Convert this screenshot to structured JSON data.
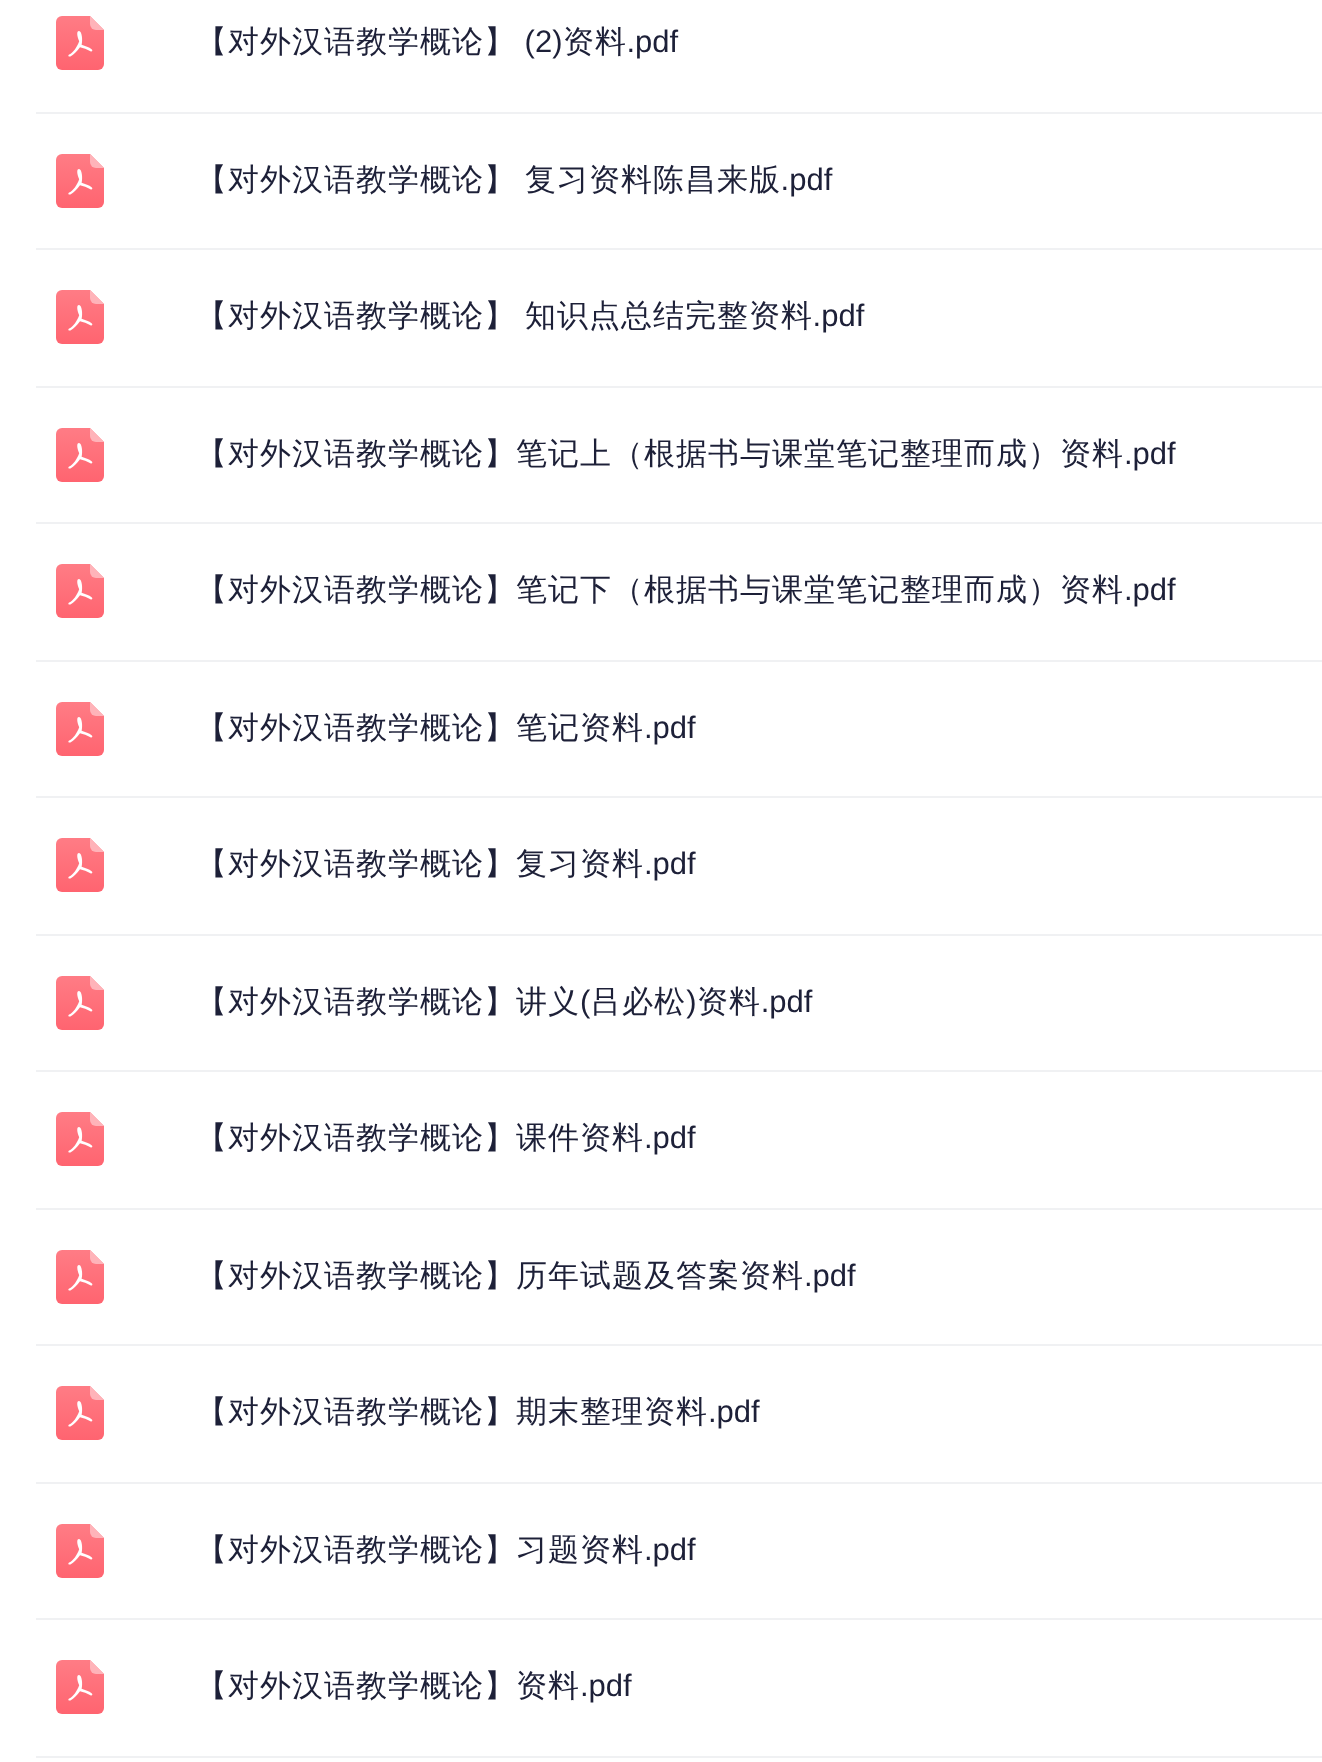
{
  "files": [
    {
      "name": "【对外汉语教学概论】 (2)资料.pdf"
    },
    {
      "name": "【对外汉语教学概论】 复习资料陈昌来版.pdf"
    },
    {
      "name": "【对外汉语教学概论】 知识点总结完整资料.pdf"
    },
    {
      "name": "【对外汉语教学概论】笔记上（根据书与课堂笔记整理而成）资料.pdf"
    },
    {
      "name": "【对外汉语教学概论】笔记下（根据书与课堂笔记整理而成）资料.pdf"
    },
    {
      "name": "【对外汉语教学概论】笔记资料.pdf"
    },
    {
      "name": "【对外汉语教学概论】复习资料.pdf"
    },
    {
      "name": "【对外汉语教学概论】讲义(吕必松)资料.pdf"
    },
    {
      "name": "【对外汉语教学概论】课件资料.pdf"
    },
    {
      "name": "【对外汉语教学概论】历年试题及答案资料.pdf"
    },
    {
      "name": "【对外汉语教学概论】期末整理资料.pdf"
    },
    {
      "name": "【对外汉语教学概论】习题资料.pdf"
    },
    {
      "name": "【对外汉语教学概论】资料.pdf"
    }
  ]
}
